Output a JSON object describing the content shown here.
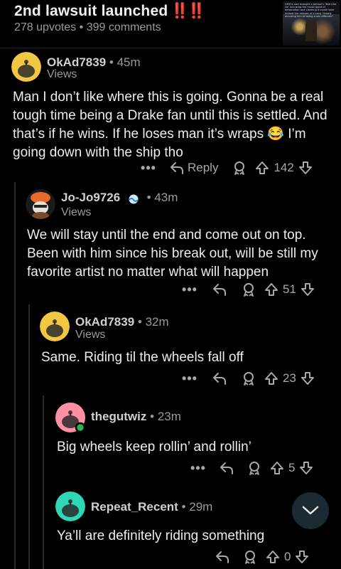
{
  "post": {
    "title": "2nd lawsuit launched",
    "title_emoji": "‼️‼️",
    "upvotes": "278 upvotes",
    "separator": "•",
    "comments": "399 comments",
    "thumbnail_caption": "UMG's own brought a person's \"Not Like Us\" accusing the music giant of defamation and claiming it could have tanked the release of a song \"falsely accusing him of being a sex offender\""
  },
  "comments": [
    {
      "username": "OkAd7839",
      "time": "45m",
      "flair": "Views",
      "body": "Man I don’t like where this is going. Gonna be a real tough time being a Drake fan until this is settled. And that’s if he wins. If he loses man it’s wraps 😂 I’m going down with the ship tho",
      "reply_label": "Reply",
      "votes": "142",
      "avatar_color": "#f2c744"
    },
    {
      "username": "Jo-Jo9726",
      "time": "43m",
      "flair": "Views",
      "body": "We will stay until the end and come out on top. Been with him since his break out, will be still my favorite artist no matter what will happen",
      "votes": "51",
      "avatar_color": "#e86a2c"
    },
    {
      "username": "OkAd7839",
      "time": "32m",
      "flair": "Views",
      "body": "Same. Riding til the wheels fall off",
      "votes": "23",
      "avatar_color": "#f2c744"
    },
    {
      "username": "thegutwiz",
      "time": "23m",
      "body": "Big wheels keep rollin’ and rollin’",
      "votes": "5",
      "avatar_color": "#ff8fa3",
      "online_color": "#2bb24c"
    },
    {
      "username": "Repeat_Recent",
      "time": "29m",
      "body": "Ya’ll are definitely riding something",
      "votes": "0",
      "avatar_color": "#2fd6b5"
    }
  ],
  "icons": {
    "more": "more-icon",
    "reply": "reply-arrow-icon",
    "award": "award-icon",
    "upvote": "upvote-icon",
    "downvote": "downvote-icon",
    "collapse": "chevron-down-icon"
  },
  "more_glyph": "•••"
}
